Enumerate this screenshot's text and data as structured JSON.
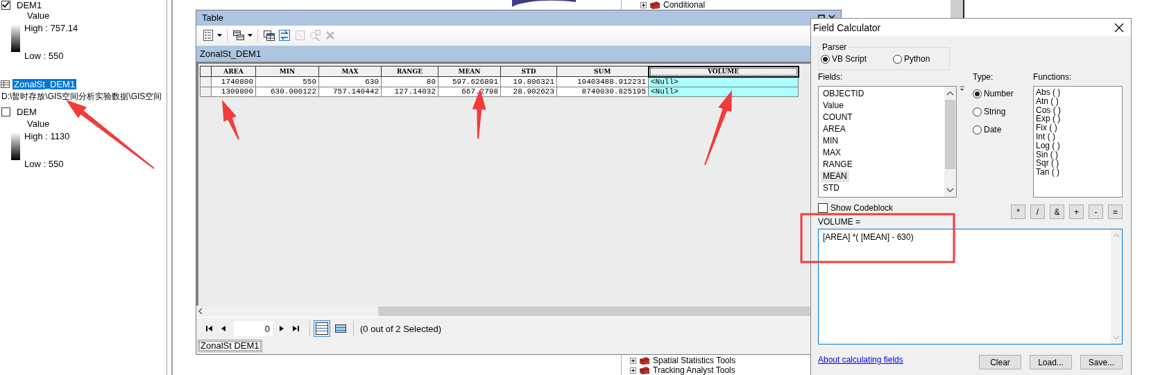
{
  "toc": {
    "layers": [
      {
        "kind": "raster",
        "name": "DEM1",
        "checked": true,
        "legend": {
          "field": "Value",
          "high": "High : 757.14",
          "low": "Low : 550"
        }
      },
      {
        "kind": "table",
        "name": "ZonalSt_DEM1",
        "selected": true,
        "path": "D:\\暂时存放\\GIS空间分析实验数据\\GIS空间"
      },
      {
        "kind": "raster",
        "name": "DEM",
        "checked": false,
        "legend": {
          "field": "Value",
          "high": "High : 1130",
          "low": "Low : 550"
        }
      }
    ]
  },
  "catalog": {
    "top_items": [
      {
        "label": "Conditional",
        "expanded": false
      }
    ],
    "bottom_items": [
      {
        "label": "Spatial Statistics Tools",
        "expanded": false
      },
      {
        "label": "Tracking Analyst Tools",
        "expanded": false
      }
    ]
  },
  "table_window": {
    "title": "Table",
    "toolbar": [
      {
        "kind": "options",
        "disabled": false
      },
      {
        "kind": "related",
        "disabled": false
      },
      {
        "kind": "select",
        "disabled": false
      },
      {
        "kind": "switch",
        "disabled": false
      },
      {
        "kind": "clear",
        "disabled": true
      },
      {
        "kind": "zoom",
        "disabled": true
      },
      {
        "kind": "delete",
        "disabled": true
      }
    ],
    "table_name": "ZonalSt_DEM1",
    "columns": [
      {
        "label": "AREA",
        "selected": false
      },
      {
        "label": "MIN",
        "selected": false
      },
      {
        "label": "MAX",
        "selected": false
      },
      {
        "label": "RANGE",
        "selected": false
      },
      {
        "label": "MEAN",
        "selected": false
      },
      {
        "label": "STD",
        "selected": false
      },
      {
        "label": "SUM",
        "selected": false
      },
      {
        "label": "VOLUME",
        "selected": true
      }
    ],
    "rows": [
      {
        "cells": [
          "1740800",
          "550",
          "630",
          "80",
          "597.626891",
          "19.806321",
          "10403488.912231",
          "<Null>"
        ]
      },
      {
        "cells": [
          "1309800",
          "630.000122",
          "757.140442",
          "127.14032",
          "667.2798",
          "28.902623",
          "8740030.825195",
          "<Null>"
        ]
      }
    ],
    "record": "0",
    "views": [
      {
        "kind": "all",
        "selected": true
      },
      {
        "kind": "selected",
        "selected": false
      }
    ],
    "selection_status": "(0 out of 2 Selected)",
    "tabs": [
      {
        "label": "ZonalSt DEM1",
        "selected": true
      }
    ]
  },
  "field_calculator": {
    "title": "Field Calculator",
    "parser": {
      "label": "Parser",
      "options": [
        {
          "label": "VB Script",
          "selected": true
        },
        {
          "label": "Python",
          "selected": false
        }
      ]
    },
    "fields_label": "Fields:",
    "fields": [
      {
        "label": "OBJECTID",
        "selected": false
      },
      {
        "label": "Value",
        "selected": false
      },
      {
        "label": "COUNT",
        "selected": false
      },
      {
        "label": "AREA",
        "selected": false
      },
      {
        "label": "MIN",
        "selected": false
      },
      {
        "label": "MAX",
        "selected": false
      },
      {
        "label": "RANGE",
        "selected": false
      },
      {
        "label": "MEAN",
        "selected": true
      },
      {
        "label": "STD",
        "selected": false
      }
    ],
    "type_label": "Type:",
    "types": [
      {
        "label": "Number",
        "selected": true
      },
      {
        "label": "String",
        "selected": false
      },
      {
        "label": "Date",
        "selected": false
      }
    ],
    "functions_label": "Functions:",
    "functions": [
      {
        "label": "Abs ( )",
        "selected": false
      },
      {
        "label": "Atn ( )",
        "selected": false
      },
      {
        "label": "Cos ( )",
        "selected": false
      },
      {
        "label": "Exp ( )",
        "selected": false
      },
      {
        "label": "Fix ( )",
        "selected": false
      },
      {
        "label": "Int ( )",
        "selected": false
      },
      {
        "label": "Log ( )",
        "selected": false
      },
      {
        "label": "Sin ( )",
        "selected": false
      },
      {
        "label": "Sqr ( )",
        "selected": false
      },
      {
        "label": "Tan ( )",
        "selected": false
      }
    ],
    "show_codeblock": {
      "label": "Show Codeblock",
      "checked": false
    },
    "operators": [
      "*",
      "/",
      "&",
      "+",
      "-",
      "="
    ],
    "expression_label": "VOLUME =",
    "expression": "[AREA] *( [MEAN] - 630)",
    "help_link": "About calculating fields",
    "buttons": [
      "Clear",
      "Load...",
      "Save..."
    ]
  },
  "annotations": [
    {
      "kind": "arrow"
    },
    {
      "kind": "arrow"
    },
    {
      "kind": "arrow"
    },
    {
      "kind": "arrow"
    },
    {
      "kind": "rectangle"
    }
  ]
}
